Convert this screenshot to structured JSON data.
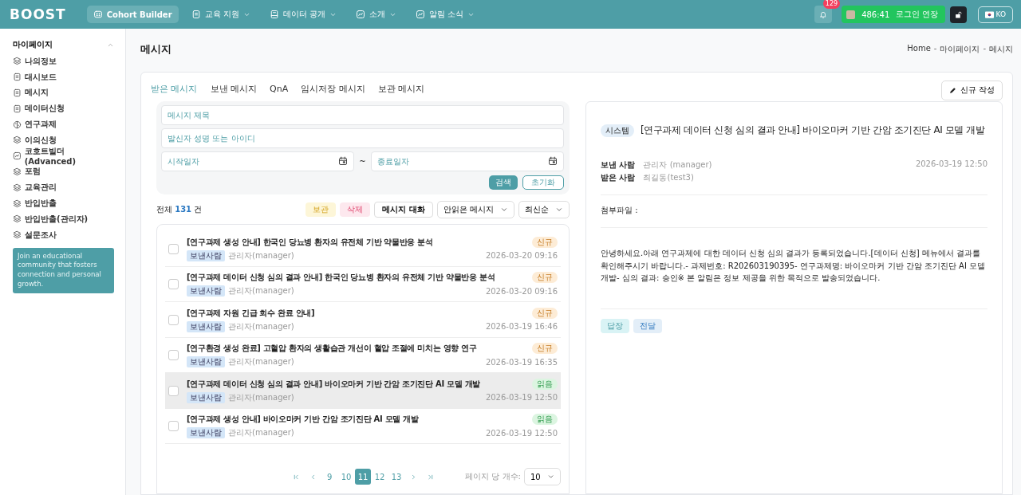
{
  "header": {
    "logo": "BOOST",
    "nav": [
      {
        "label": "Cohort Builder",
        "kind": "grid",
        "selected": true,
        "dropdown": false
      },
      {
        "label": "교육 지원",
        "kind": "doc",
        "selected": false,
        "dropdown": true
      },
      {
        "label": "데이터 공개",
        "kind": "book",
        "selected": false,
        "dropdown": true
      },
      {
        "label": "소개",
        "kind": "chart",
        "selected": false,
        "dropdown": true
      },
      {
        "label": "알림 소식",
        "kind": "chart",
        "selected": false,
        "dropdown": true
      }
    ],
    "notification_count": "129",
    "session_time": "486:41",
    "session_button": "로그인 연장",
    "language": "KO"
  },
  "sidebar": {
    "title": "마이페이지",
    "expanded": true,
    "items": [
      {
        "label": "나의정보",
        "kind": "stack"
      },
      {
        "label": "대시보드",
        "kind": "doc"
      },
      {
        "label": "메시지",
        "kind": "doc"
      },
      {
        "label": "데이터신청",
        "kind": "doc"
      },
      {
        "label": "연구과제",
        "kind": "brain"
      },
      {
        "label": "이의신청",
        "kind": "stack"
      },
      {
        "label": "코호트빌더(Advanced)",
        "kind": "chart"
      },
      {
        "label": "포럼",
        "kind": "stack"
      },
      {
        "label": "교육관리",
        "kind": "stack"
      },
      {
        "label": "반입반출",
        "kind": "stack"
      },
      {
        "label": "반입반출(관리자)",
        "kind": "stack"
      },
      {
        "label": "설문조사",
        "kind": "stack"
      }
    ],
    "promo": "Join an educational community that fosters connection and personal growth."
  },
  "page": {
    "title": "메시지",
    "breadcrumb": [
      "Home",
      "-",
      "마이페이지",
      "-",
      "메시지"
    ]
  },
  "tabs": [
    {
      "label": "받은 메시지",
      "selected": true
    },
    {
      "label": "보낸 메시지",
      "selected": false
    },
    {
      "label": "QnA",
      "selected": false
    },
    {
      "label": "임시저장 메시지",
      "selected": false
    },
    {
      "label": "보관 메시지",
      "selected": false
    }
  ],
  "compose_button": "신규 작성",
  "filters": {
    "title_placeholder": "메시지 제목",
    "sender_placeholder": "발신자 성명 또는 아이디",
    "start_placeholder": "시작일자",
    "range_separator": "~",
    "end_placeholder": "종료일자",
    "search_button": "검색",
    "reset_button": "초기화"
  },
  "list_toolbar": {
    "total_prefix": "전체",
    "total_count": "131",
    "total_suffix": "건",
    "archive_button": "보관",
    "delete_button": "삭제",
    "conversation_button": "메시지 대화",
    "read_filter": "안읽은 메시지",
    "sort": "최신순"
  },
  "messages": [
    {
      "title": "[연구과제 생성 안내] 한국인 당뇨병 환자의 유전체 기반 약물반응 분석",
      "sender_tag": "보낸사람",
      "sender": "관리자(manager)",
      "status": "신규",
      "kind": "new",
      "date": "2026-03-20 09:16",
      "checked": false,
      "selected": false
    },
    {
      "title": "[연구과제 데이터 신청 심의 결과 안내] 한국인 당뇨병 환자의 유전체 기반 약물반응 분석",
      "sender_tag": "보낸사람",
      "sender": "관리자(manager)",
      "status": "신규",
      "kind": "new",
      "date": "2026-03-20 09:16",
      "checked": false,
      "selected": false
    },
    {
      "title": "[연구과제 자원 긴급 회수 완료 안내]",
      "sender_tag": "보낸사람",
      "sender": "관리자(manager)",
      "status": "신규",
      "kind": "new",
      "date": "2026-03-19 16:46",
      "checked": false,
      "selected": false
    },
    {
      "title": "[연구환경 생성 완료] 고혈압 환자의 생활습관 개선이 혈압 조절에 미치는 영향 연구",
      "sender_tag": "보낸사람",
      "sender": "관리자(manager)",
      "status": "신규",
      "kind": "new",
      "date": "2026-03-19 16:35",
      "checked": false,
      "selected": false
    },
    {
      "title": "[연구과제 데이터 신청 심의 결과 안내] 바이오마커 기반 간암 조기진단 AI 모델 개발",
      "sender_tag": "보낸사람",
      "sender": "관리자(manager)",
      "status": "읽음",
      "kind": "read",
      "date": "2026-03-19 12:50",
      "checked": false,
      "selected": true
    },
    {
      "title": "[연구과제 생성 안내] 바이오마커 기반 간암 조기진단 AI 모델 개발",
      "sender_tag": "보낸사람",
      "sender": "관리자(manager)",
      "status": "읽음",
      "kind": "read",
      "date": "2026-03-19 12:50",
      "checked": false,
      "selected": false
    }
  ],
  "pagination": {
    "pages": [
      {
        "label": "9",
        "selected": false
      },
      {
        "label": "10",
        "selected": false
      },
      {
        "label": "11",
        "selected": true
      },
      {
        "label": "12",
        "selected": false
      },
      {
        "label": "13",
        "selected": false
      }
    ],
    "page_size_label": "페이지 당 개수:",
    "page_size": "10"
  },
  "detail": {
    "tag": "시스템",
    "title": "[연구과제 데이터 신청 심의 결과 안내] 바이오마커 기반 간암 조기진단 AI 모델 개발",
    "sender_label": "보낸 사람",
    "sender": "관리자 (manager)",
    "recipient_label": "받은 사람",
    "recipient": "최길동(test3)",
    "date": "2026-03-19 12:50",
    "attachment_label": "첨부파일 :",
    "body": "안녕하세요.아래 연구과제에 대한 데이터 신청 심의 결과가 등록되었습니다.[데이터 신청] 메뉴에서 결과를 확인해주시기 바랍니다.- 과제번호: R202603190395- 연구과제명: 바이오마커 기반 간암 조기진단 AI 모델 개발- 심의 결과: 승인※ 본 알림은 정보 제공을 위한 목적으로 발송되었습니다.",
    "reply_button": "답장",
    "forward_button": "전달"
  }
}
